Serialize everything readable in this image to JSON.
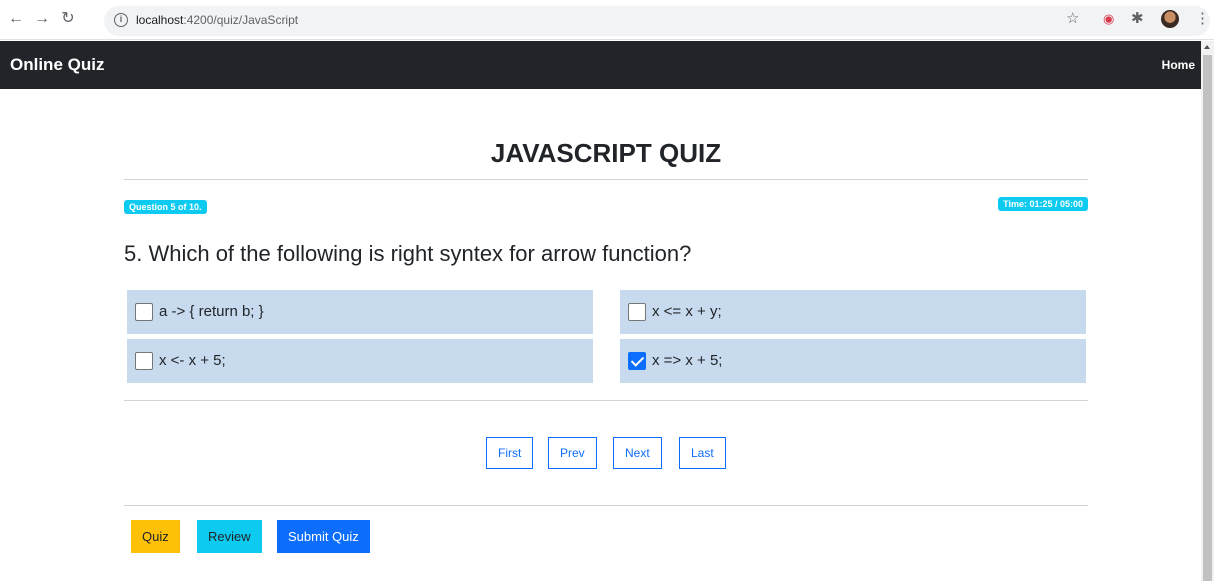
{
  "browser": {
    "url_host": "localhost",
    "url_rest": ":4200/quiz/JavaScript",
    "icons": [
      "back-arrow-icon",
      "forward-arrow-icon",
      "reload-icon",
      "info-icon",
      "star-icon",
      "pocket-icon",
      "extensions-icon",
      "profile-avatar",
      "menu-dots-icon"
    ]
  },
  "navbar": {
    "brand": "Online Quiz",
    "home": "Home"
  },
  "quiz": {
    "title": "JAVASCRIPT QUIZ",
    "progress_badge": "Question 5 of 10.",
    "timer_badge": "Time: 01:25 / 05:00",
    "question": "5. Which of the following is right syntex for arrow function?",
    "options": [
      {
        "text": "a -> { return b; }",
        "checked": false
      },
      {
        "text": "x <= x + y;",
        "checked": false
      },
      {
        "text": "x <- x + 5;",
        "checked": false
      },
      {
        "text": "x => x + 5;",
        "checked": true
      }
    ]
  },
  "pager": {
    "first": "First",
    "prev": "Prev",
    "next": "Next",
    "last": "Last"
  },
  "actions": {
    "quiz": "Quiz",
    "review": "Review",
    "submit": "Submit Quiz"
  },
  "colors": {
    "navbar_bg": "#212529",
    "badge_info": "#0dcaf0",
    "option_bg": "#c8daee",
    "primary": "#0d6efd",
    "warning": "#ffc107"
  }
}
